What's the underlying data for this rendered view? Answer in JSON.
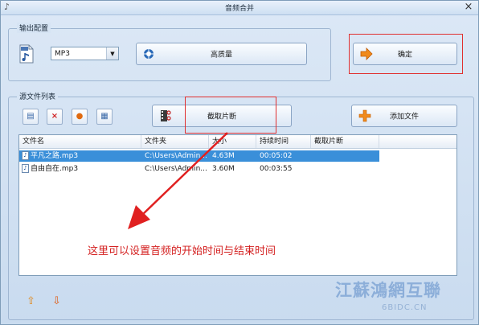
{
  "window": {
    "title": "音频合并"
  },
  "output": {
    "group_label": "输出配置",
    "format_value": "MP3",
    "quality_label": "高质量",
    "confirm_label": "确定"
  },
  "source": {
    "group_label": "源文件列表",
    "clip_label": "截取片断",
    "add_label": "添加文件"
  },
  "table": {
    "columns": [
      "文件名",
      "文件夹",
      "大小",
      "持续时间",
      "截取片断"
    ],
    "rows": [
      {
        "name": "平凡之路.mp3",
        "folder": "C:\\Users\\Admin...",
        "size": "4.63M",
        "duration": "00:05:02",
        "clip": ""
      },
      {
        "name": "自由自在.mp3",
        "folder": "C:\\Users\\Admin...",
        "size": "3.60M",
        "duration": "00:03:55",
        "clip": ""
      }
    ]
  },
  "annotation": "这里可以设置音频的开始时间与结束时间",
  "watermark": {
    "main": "江蘇鴻網互聯",
    "sub": "6BIDC.CN"
  },
  "colors": {
    "annotation": "#d42020",
    "selection": "#3a8fd9",
    "highlight_box": "#e03030"
  }
}
